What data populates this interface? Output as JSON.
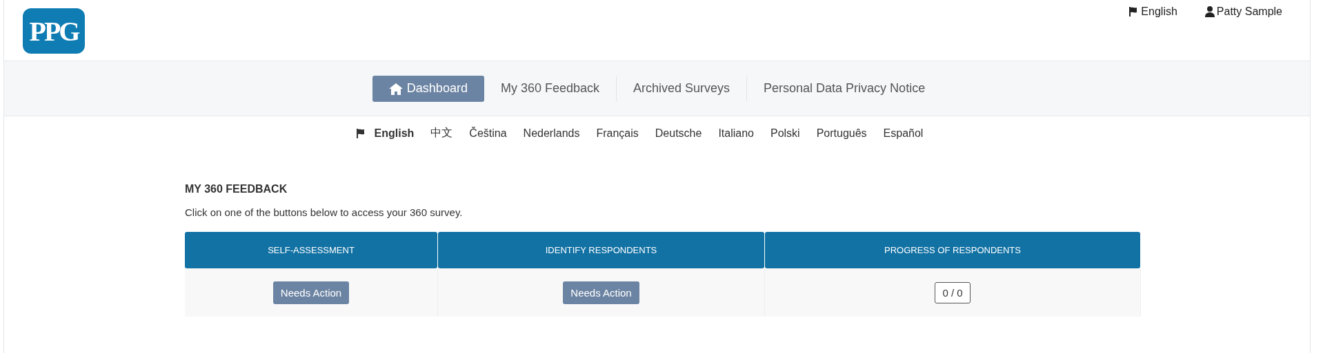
{
  "logo": {
    "text": "PPG"
  },
  "top_bar": {
    "language": "English",
    "user": "Patty Sample"
  },
  "nav_tabs": [
    {
      "label": "Dashboard",
      "selected": true
    },
    {
      "label": "My 360 Feedback",
      "selected": false
    },
    {
      "label": "Archived Surveys",
      "selected": false
    },
    {
      "label": "Personal Data Privacy Notice",
      "selected": false
    }
  ],
  "languages": [
    {
      "label": "English",
      "selected": true
    },
    {
      "label": "中文",
      "selected": false
    },
    {
      "label": "Čeština",
      "selected": false
    },
    {
      "label": "Nederlands",
      "selected": false
    },
    {
      "label": "Français",
      "selected": false
    },
    {
      "label": "Deutsche",
      "selected": false
    },
    {
      "label": "Italiano",
      "selected": false
    },
    {
      "label": "Polski",
      "selected": false
    },
    {
      "label": "Português",
      "selected": false
    },
    {
      "label": "Español",
      "selected": false
    }
  ],
  "section": {
    "title": "MY 360 FEEDBACK",
    "intro": "Click on one of the buttons below to access your 360 survey."
  },
  "table": {
    "columns": [
      "SELF-ASSESSMENT",
      "IDENTIFY RESPONDENTS",
      "PROGRESS OF RESPONDENTS"
    ],
    "cells": [
      {
        "kind": "button",
        "text": "Needs Action"
      },
      {
        "kind": "button",
        "text": "Needs Action"
      },
      {
        "kind": "counter",
        "text": "0 / 0"
      }
    ]
  }
}
